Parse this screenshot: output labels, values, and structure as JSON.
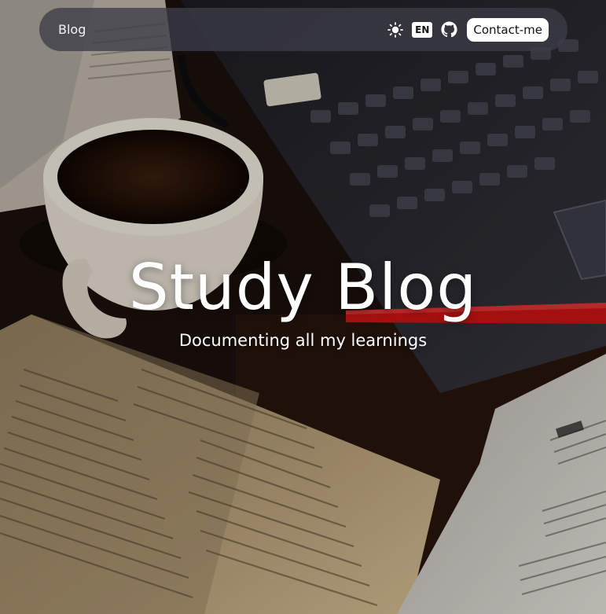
{
  "nav": {
    "brand": "Blog",
    "theme_icon": "sun-icon",
    "language": "EN",
    "github_icon": "github-icon",
    "contact_label": "Contact-me"
  },
  "hero": {
    "title": "Study Blog",
    "subtitle": "Documenting all my learnings",
    "background": "photo of a coffee cup, open book, red pen, laptop keyboard and newspaper on a wooden desk"
  },
  "colors": {
    "navbar_bg": "#3c3c46",
    "text": "#ffffff",
    "button_bg": "#ffffff",
    "button_text": "#111111",
    "accent_red": "#c81414"
  }
}
